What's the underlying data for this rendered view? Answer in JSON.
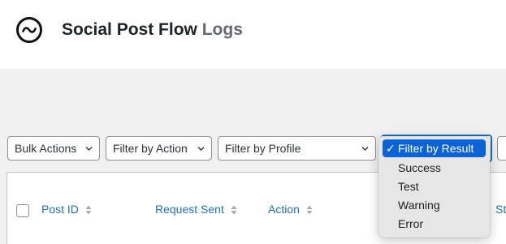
{
  "header": {
    "title": "Social Post Flow",
    "title_suffix": "Logs",
    "logo_icon": "social-post-flow-logo-icon"
  },
  "filters": {
    "bulk_actions": "Bulk Actions",
    "filter_by_action": "Filter by Action",
    "filter_by_profile": "Filter by Profile",
    "filter_by_result": "Filter by Result"
  },
  "result_dropdown": {
    "selected": "Filter by Result",
    "check_mark": "✓",
    "options": [
      "Success",
      "Test",
      "Warning",
      "Error"
    ]
  },
  "table": {
    "columns": [
      "Post ID",
      "Request Sent",
      "Action",
      "St"
    ]
  },
  "colors": {
    "link": "#2271b1",
    "selected_option": "#0a63d6",
    "header_bg": "#ffffff",
    "page_bg": "#f0f0f1"
  }
}
